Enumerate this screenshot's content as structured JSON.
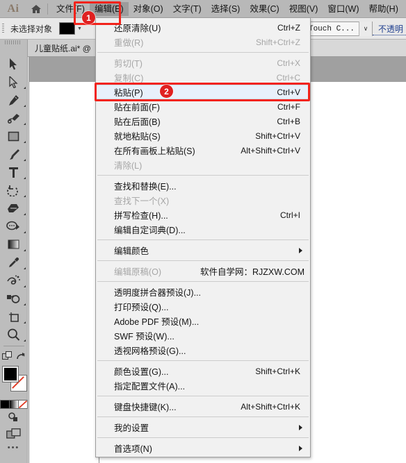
{
  "app": {
    "logo_text": "Ai",
    "home_icon": "home-icon"
  },
  "menubar": {
    "items": [
      {
        "label": "文件(F)",
        "active": false
      },
      {
        "label": "编辑(E)",
        "active": true
      },
      {
        "label": "对象(O)",
        "active": false
      },
      {
        "label": "文字(T)",
        "active": false
      },
      {
        "label": "选择(S)",
        "active": false
      },
      {
        "label": "效果(C)",
        "active": false
      },
      {
        "label": "视图(V)",
        "active": false
      },
      {
        "label": "窗口(W)",
        "active": false
      },
      {
        "label": "帮助(H)",
        "active": false
      }
    ]
  },
  "controlbar": {
    "selection_status": "未选择对象",
    "fill_color": "#000000",
    "brush_name": "Touch C...",
    "opacity_label": "不透明"
  },
  "tabbar": {
    "document_tab": "儿童贴纸.ai* @"
  },
  "toolbar": {
    "tools": [
      "selection-tool",
      "direct-selection-tool",
      "pen-tool",
      "blob-brush-tool",
      "rectangle-tool",
      "paintbrush-tool",
      "type-tool",
      "rotate-tool",
      "eraser-tool",
      "width-tool",
      "gradient-tool",
      "eyedropper-tool",
      "symbol-sprayer-tool",
      "shape-builder-tool",
      "artboard-tool",
      "zoom-tool"
    ],
    "fill_color": "#000000",
    "stroke_color": "#ffffff"
  },
  "menu": {
    "title": "编辑(E)",
    "groups": [
      {
        "items": [
          {
            "label": "还原清除(U)",
            "accel": "Ctrl+Z",
            "disabled": false,
            "submenu": false,
            "highlight": false
          },
          {
            "label": "重做(R)",
            "accel": "Shift+Ctrl+Z",
            "disabled": true,
            "submenu": false,
            "highlight": false
          }
        ]
      },
      {
        "items": [
          {
            "label": "剪切(T)",
            "accel": "Ctrl+X",
            "disabled": true,
            "submenu": false,
            "highlight": false
          },
          {
            "label": "复制(C)",
            "accel": "Ctrl+C",
            "disabled": true,
            "submenu": false,
            "highlight": false
          },
          {
            "label": "粘贴(P)",
            "accel": "Ctrl+V",
            "disabled": false,
            "submenu": false,
            "highlight": true
          },
          {
            "label": "贴在前面(F)",
            "accel": "Ctrl+F",
            "disabled": false,
            "submenu": false,
            "highlight": false
          },
          {
            "label": "贴在后面(B)",
            "accel": "Ctrl+B",
            "disabled": false,
            "submenu": false,
            "highlight": false
          },
          {
            "label": "就地粘贴(S)",
            "accel": "Shift+Ctrl+V",
            "disabled": false,
            "submenu": false,
            "highlight": false
          },
          {
            "label": "在所有画板上粘贴(S)",
            "accel": "Alt+Shift+Ctrl+V",
            "disabled": false,
            "submenu": false,
            "highlight": false
          },
          {
            "label": "清除(L)",
            "accel": "",
            "disabled": true,
            "submenu": false,
            "highlight": false
          }
        ]
      },
      {
        "items": [
          {
            "label": "查找和替换(E)...",
            "accel": "",
            "disabled": false,
            "submenu": false,
            "highlight": false
          },
          {
            "label": "查找下一个(X)",
            "accel": "",
            "disabled": true,
            "submenu": false,
            "highlight": false
          },
          {
            "label": "拼写检查(H)...",
            "accel": "Ctrl+I",
            "disabled": false,
            "submenu": false,
            "highlight": false
          },
          {
            "label": "编辑自定词典(D)...",
            "accel": "",
            "disabled": false,
            "submenu": false,
            "highlight": false
          }
        ]
      },
      {
        "items": [
          {
            "label": "编辑颜色",
            "accel": "",
            "disabled": false,
            "submenu": true,
            "highlight": false
          }
        ]
      },
      {
        "items": [
          {
            "label": "编辑原稿(O)",
            "accel": "",
            "disabled": true,
            "submenu": false,
            "highlight": false,
            "watermark": "软件自学网：RJZXW.COM"
          }
        ]
      },
      {
        "items": [
          {
            "label": "透明度拼合器预设(J)...",
            "accel": "",
            "disabled": false,
            "submenu": false,
            "highlight": false
          },
          {
            "label": "打印预设(Q)...",
            "accel": "",
            "disabled": false,
            "submenu": false,
            "highlight": false
          },
          {
            "label": "Adobe PDF 预设(M)...",
            "accel": "",
            "disabled": false,
            "submenu": false,
            "highlight": false
          },
          {
            "label": "SWF 预设(W)...",
            "accel": "",
            "disabled": false,
            "submenu": false,
            "highlight": false
          },
          {
            "label": "透视网格预设(G)...",
            "accel": "",
            "disabled": false,
            "submenu": false,
            "highlight": false
          }
        ]
      },
      {
        "items": [
          {
            "label": "颜色设置(G)...",
            "accel": "Shift+Ctrl+K",
            "disabled": false,
            "submenu": false,
            "highlight": false
          },
          {
            "label": "指定配置文件(A)...",
            "accel": "",
            "disabled": false,
            "submenu": false,
            "highlight": false
          }
        ]
      },
      {
        "items": [
          {
            "label": "键盘快捷键(K)...",
            "accel": "Alt+Shift+Ctrl+K",
            "disabled": false,
            "submenu": false,
            "highlight": false
          }
        ]
      },
      {
        "items": [
          {
            "label": "我的设置",
            "accel": "",
            "disabled": false,
            "submenu": true,
            "highlight": false
          }
        ]
      },
      {
        "items": [
          {
            "label": "首选项(N)",
            "accel": "",
            "disabled": false,
            "submenu": true,
            "highlight": false
          }
        ]
      }
    ]
  },
  "annotations": {
    "accent_color": "#f2231b",
    "badges": [
      {
        "number": "1",
        "target": "编辑(E)"
      },
      {
        "number": "2",
        "target": "粘贴(P)"
      }
    ]
  }
}
